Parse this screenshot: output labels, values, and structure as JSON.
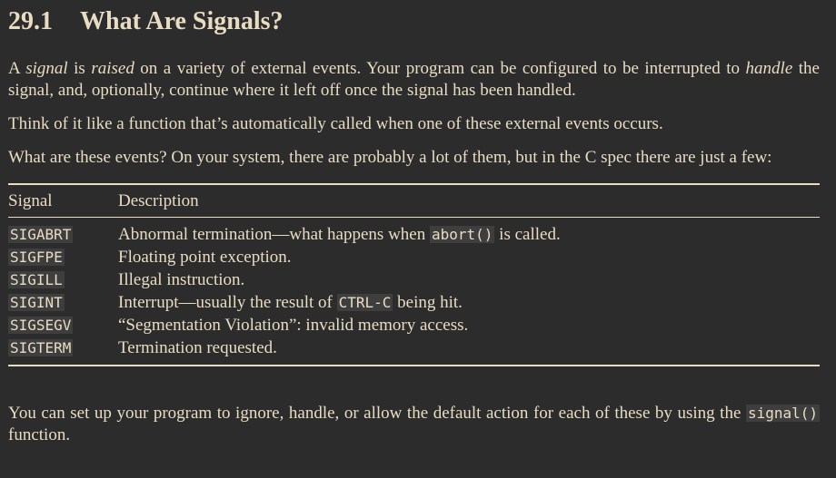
{
  "section": {
    "number": "29.1",
    "title": "What Are Signals?"
  },
  "para1": {
    "t1": "A ",
    "signal": "signal",
    "t2": " is ",
    "raised": "raised",
    "t3": " on a variety of external events. Your program can be configured to be interrupted to ",
    "handle": "handle",
    "t4": " the signal, and, optionally, continue where it left off once the signal has been handled."
  },
  "para2": "Think of it like a function that’s automatically called when one of these external events occurs.",
  "para3": "What are these events? On your system, there are probably a lot of them, but in the C spec there are just a few:",
  "table": {
    "headers": [
      "Signal",
      "Description"
    ],
    "rows": [
      {
        "signal": "SIGABRT",
        "pre": "Abnormal termination—what happens when ",
        "code": "abort()",
        "post": " is called."
      },
      {
        "signal": "SIGFPE",
        "pre": "Floating point exception.",
        "code": "",
        "post": ""
      },
      {
        "signal": "SIGILL",
        "pre": "Illegal instruction.",
        "code": "",
        "post": ""
      },
      {
        "signal": "SIGINT",
        "pre": "Interrupt—usually the result of ",
        "code": "CTRL-C",
        "post": " being hit."
      },
      {
        "signal": "SIGSEGV",
        "pre": "“Segmentation Violation”: invalid memory access.",
        "code": "",
        "post": ""
      },
      {
        "signal": "SIGTERM",
        "pre": "Termination requested.",
        "code": "",
        "post": ""
      }
    ]
  },
  "para4": {
    "t1": "You can set up your program to ignore, handle, or allow the default action for each of these by using the ",
    "code": "signal()",
    "t2": " function."
  }
}
